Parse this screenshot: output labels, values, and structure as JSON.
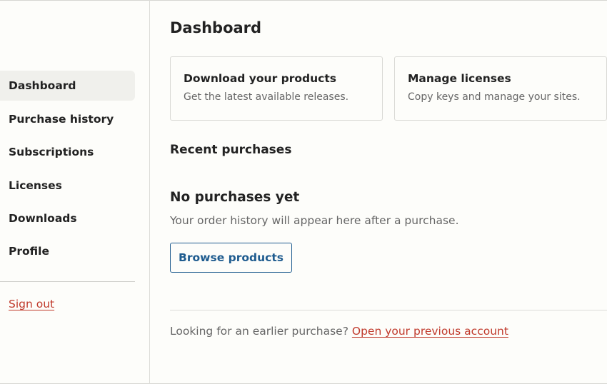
{
  "sidebar": {
    "items": [
      {
        "label": "Dashboard",
        "active": true
      },
      {
        "label": "Purchase history",
        "active": false
      },
      {
        "label": "Subscriptions",
        "active": false
      },
      {
        "label": "Licenses",
        "active": false
      },
      {
        "label": "Downloads",
        "active": false
      },
      {
        "label": "Profile",
        "active": false
      }
    ],
    "sign_out": "Sign out"
  },
  "main": {
    "title": "Dashboard",
    "cards": [
      {
        "title": "Download your products",
        "description": "Get the latest available releases."
      },
      {
        "title": "Manage licenses",
        "description": "Copy keys and manage your sites."
      }
    ],
    "recent_purchases": {
      "heading": "Recent purchases",
      "empty_title": "No purchases yet",
      "empty_description": "Your order history will appear here after a purchase.",
      "browse_label": "Browse products"
    },
    "footer": {
      "text": "Looking for an earlier purchase?",
      "link": "Open your previous account"
    }
  },
  "colors": {
    "background": "#fdfdfa",
    "active_nav": "#f0f0ec",
    "link_red": "#c0392b",
    "button_blue": "#1f5c8f"
  }
}
